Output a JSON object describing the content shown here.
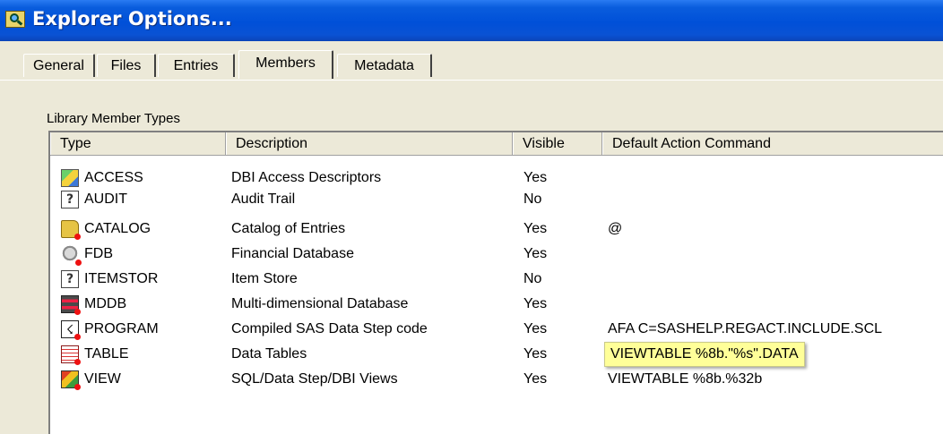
{
  "window": {
    "title": "Explorer Options...",
    "icon": "explorer-icon"
  },
  "tabs": [
    {
      "label": "General",
      "active": false
    },
    {
      "label": "Files",
      "active": false
    },
    {
      "label": "Entries",
      "active": false
    },
    {
      "label": "Members",
      "active": true
    },
    {
      "label": "Metadata",
      "active": false
    }
  ],
  "group": {
    "label": "Library Member Types"
  },
  "columns": {
    "type": "Type",
    "description": "Description",
    "visible": "Visible",
    "command": "Default Action Command"
  },
  "rows": [
    {
      "type": "ACCESS",
      "description": "DBI Access Descriptors",
      "visible": "Yes",
      "command": "",
      "icon": "access-icon"
    },
    {
      "type": "AUDIT",
      "description": "Audit Trail",
      "visible": "No",
      "command": "",
      "icon": "unknown-icon"
    },
    {
      "type": "CATALOG",
      "description": "Catalog of Entries",
      "visible": "Yes",
      "command": "@",
      "icon": "catalog-icon"
    },
    {
      "type": "FDB",
      "description": "Financial Database",
      "visible": "Yes",
      "command": "",
      "icon": "fdb-icon"
    },
    {
      "type": "ITEMSTOR",
      "description": "Item Store",
      "visible": "No",
      "command": "",
      "icon": "unknown-icon"
    },
    {
      "type": "MDDB",
      "description": "Multi-dimensional Database",
      "visible": "Yes",
      "command": "",
      "icon": "mddb-icon"
    },
    {
      "type": "PROGRAM",
      "description": "Compiled SAS Data Step code",
      "visible": "Yes",
      "command": "AFA C=SASHELP.REGACT.INCLUDE.SCL",
      "icon": "program-icon"
    },
    {
      "type": "TABLE",
      "description": "Data Tables",
      "visible": "Yes",
      "command": "VIEWTABLE %8b.\"%s\".DATA",
      "icon": "table-icon",
      "highlight": true
    },
    {
      "type": "VIEW",
      "description": "SQL/Data Step/DBI Views",
      "visible": "Yes",
      "command": "VIEWTABLE %8b.%32b",
      "icon": "view-icon"
    }
  ],
  "colors": {
    "titlebar": "#0054E3",
    "dialog_bg": "#ECE9D8",
    "tooltip_bg": "#FFFF99",
    "titlebar_text": "#FFFFFF"
  }
}
